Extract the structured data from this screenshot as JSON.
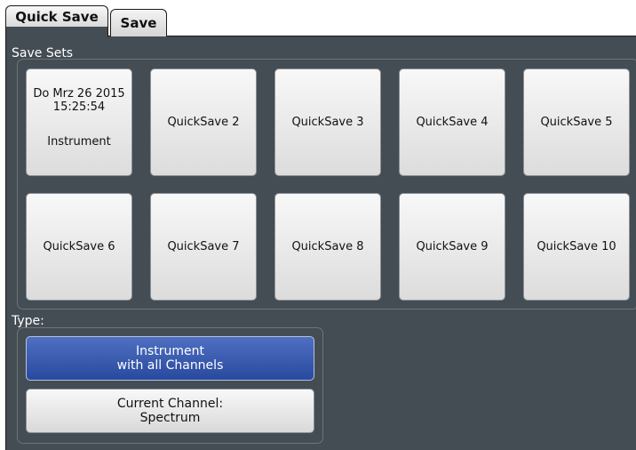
{
  "tabs": [
    {
      "label": "Quick Save",
      "active": true
    },
    {
      "label": "Save",
      "active": false
    }
  ],
  "save_sets": {
    "label": "Save Sets",
    "first": {
      "date": "Do Mrz 26 2015",
      "time": "15:25:54",
      "type": "Instrument"
    },
    "buttons": [
      "QuickSave 2",
      "QuickSave 3",
      "QuickSave 4",
      "QuickSave 5",
      "QuickSave 6",
      "QuickSave 7",
      "QuickSave 8",
      "QuickSave 9",
      "QuickSave 10"
    ]
  },
  "type_group": {
    "label": "Type:",
    "options": [
      {
        "line1": "Instrument",
        "line2": "with all Channels",
        "selected": true
      },
      {
        "line1": "Current Channel:",
        "line2": "Spectrum",
        "selected": false
      }
    ]
  },
  "colors": {
    "panel_bg": "#454d54",
    "selected_option": "#2f52a8",
    "button_face": "#e8e8e8"
  }
}
